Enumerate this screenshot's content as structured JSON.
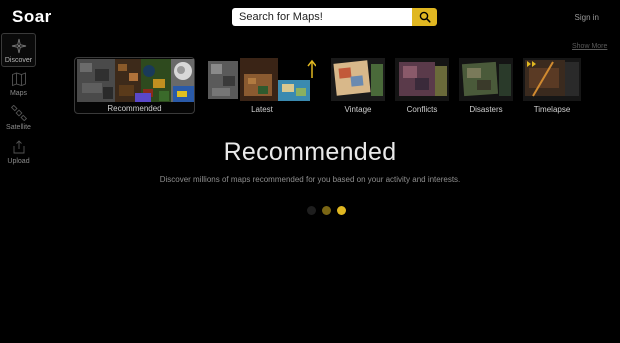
{
  "header": {
    "logo_text": "Soar",
    "search_placeholder": "Search for Maps!",
    "signin_label": "Sign in"
  },
  "sidebar": {
    "items": [
      {
        "label": "Discover",
        "icon": "compass-icon",
        "active": true
      },
      {
        "label": "Maps",
        "icon": "map-icon",
        "active": false
      },
      {
        "label": "Satellite",
        "icon": "satellite-icon",
        "active": false
      },
      {
        "label": "Upload",
        "icon": "upload-icon",
        "active": false
      }
    ]
  },
  "categories": {
    "show_more_label": "Show More",
    "items": [
      {
        "label": "Recommended",
        "selected": true
      },
      {
        "label": "Latest",
        "selected": false
      },
      {
        "label": "Vintage",
        "selected": false
      },
      {
        "label": "Conflicts",
        "selected": false
      },
      {
        "label": "Disasters",
        "selected": false
      },
      {
        "label": "Timelapse",
        "selected": false
      }
    ]
  },
  "hero": {
    "title": "Recommended",
    "subtitle": "Discover millions of maps recommended for you based on your activity and interests."
  },
  "carousel": {
    "dot_count": 3,
    "active_index": 2
  },
  "colors": {
    "accent": "#e0b721",
    "background": "#000000",
    "dot_inactive": "#7a6614",
    "dot_dim": "#1e1e1e"
  }
}
